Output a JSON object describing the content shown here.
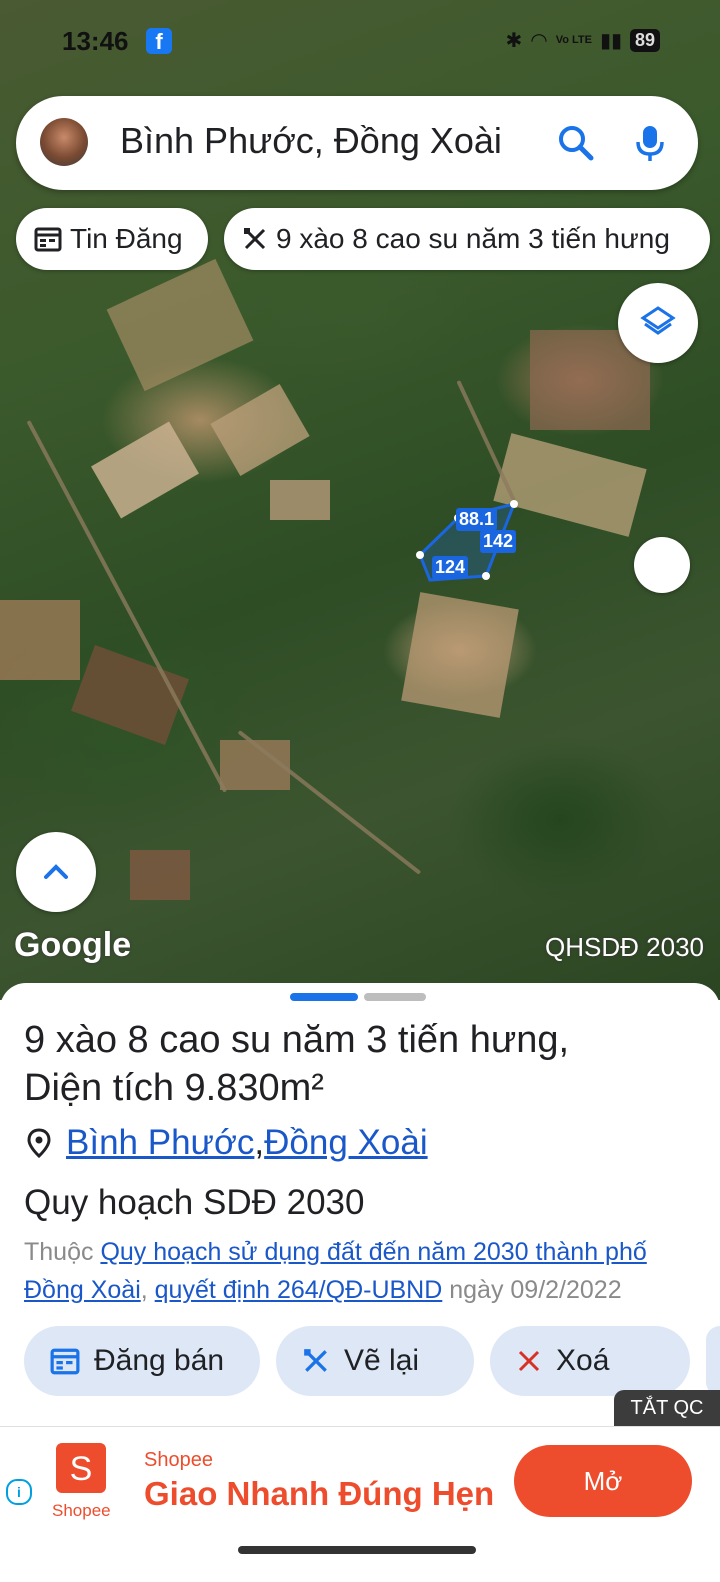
{
  "status_bar": {
    "time": "13:46",
    "network": "Vo LTE",
    "battery": "89"
  },
  "search": {
    "query": "Bình Phước, Đồng Xoài"
  },
  "chips": [
    {
      "label": "Tin Đăng",
      "icon": "calendar-icon"
    },
    {
      "label": "9 xào 8 cao su năm 3 tiến hưng",
      "icon": "draw-icon"
    }
  ],
  "map": {
    "plot_edges": [
      "88.1",
      "142",
      "124"
    ],
    "google_label": "Google",
    "plan_layer_label": "QHSDĐ 2030"
  },
  "sheet": {
    "title": "9 xào 8 cao su năm 3 tiến hưng,",
    "area_prefix": "Diện tích ",
    "area_value": "9.830m²",
    "location_province": "Bình Phước",
    "location_sep": ", ",
    "location_district": "Đồng Xoài",
    "plan_title": "Quy hoạch SDĐ 2030",
    "desc_prefix": "Thuộc ",
    "desc_link": "Quy hoạch sử dụng đất đến năm 2030 thành phố Đồng Xoài",
    "desc_sep": ", ",
    "desc_decision": "quyết định 264/QĐ-UBND",
    "desc_date": " ngày 09/2/2022",
    "actions": [
      {
        "label": "Đăng bán",
        "icon": "calendar-icon"
      },
      {
        "label": "Vẽ lại",
        "icon": "draw-icon"
      },
      {
        "label": "Xoá",
        "icon": "close-icon"
      }
    ]
  },
  "ad": {
    "close_label": "TẮT QC",
    "brand": "Shopee",
    "logo_text": "Shopee",
    "headline": "Giao Nhanh Đúng Hẹn",
    "cta": "Mở"
  },
  "colors": {
    "accent": "#1a73e8",
    "plot": "#1a66e0",
    "shopee": "#ee4d2d"
  }
}
